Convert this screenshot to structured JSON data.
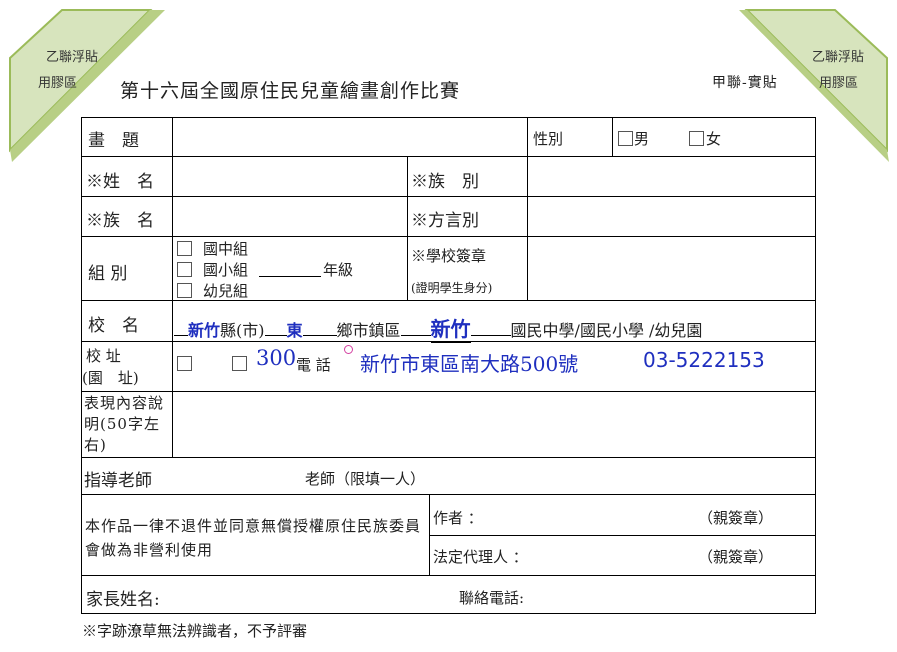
{
  "corners": {
    "left": {
      "line1": "乙聯浮貼",
      "line2": "用膠區"
    },
    "right": {
      "line1": "乙聯浮貼",
      "line2": "用膠區"
    }
  },
  "header": {
    "title": "第十六屆全國原住民兒童繪畫創作比賽",
    "copy_label": "甲聯-實貼"
  },
  "form": {
    "painting_title_label": "畫　題",
    "gender_label": "性別",
    "gender_male": "男",
    "gender_female": "女",
    "name_label": "※姓　名",
    "tribe_label": "※族　別",
    "tribe_name_label": "※族　名",
    "dialect_label": "※方言別",
    "group_label": "組 別",
    "group_options": [
      "國中組",
      "國小組",
      "幼兒組"
    ],
    "grade_suffix": "年級",
    "school_seal_label": "※學校簽章",
    "school_seal_note": "(證明學生身分)",
    "school_name_label": "校　名",
    "school_county_suffix": "縣(市)",
    "school_district_suffix": "鄉市鎮區",
    "school_type_suffix": "國民中學/國民小學 /幼兒園",
    "school_county_value": "新竹",
    "school_district_value": "東",
    "school_value": "新竹",
    "address_label_1": "校 址",
    "address_label_2": "(園　址)",
    "postal_code": "300",
    "phone_label": "電 話",
    "address_value": "新竹市東區南大路500號",
    "phone_value": "03-5222153",
    "description_label": "表現內容說明(50字左右)",
    "teacher_label": "指導老師",
    "teacher_note": "老師（限填一人）",
    "consent_text": "本作品一律不退件並同意無償授權原住民族委員會做為非營利使用",
    "author_label": "作者 ：",
    "author_seal": "（親簽章）",
    "guardian_label": "法定代理人 ：",
    "guardian_seal": "（親簽章）",
    "parent_name_label": "家長姓名:",
    "contact_phone_label": "聯絡電話:"
  },
  "footer": {
    "note": "※字跡潦草無法辨識者，不予評審"
  },
  "colors": {
    "corner_fill": "#d7e4bd",
    "corner_edge": "#9bbb59",
    "handwriting": "#1f2fbf"
  }
}
